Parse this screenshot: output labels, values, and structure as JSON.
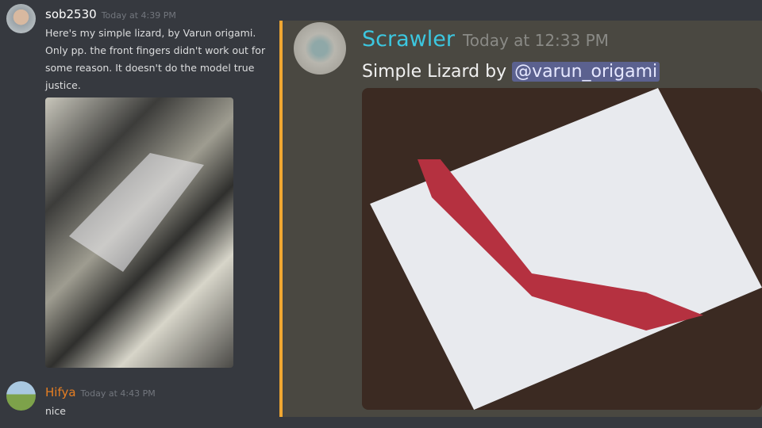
{
  "messages": [
    {
      "author": "sob2530",
      "timestamp": "Today at 4:39 PM",
      "text": "Here's my simple lizard, by Varun origami. Only pp. the front fingers didn't work out for some reason. It doesn't do the model true justice.",
      "author_color": "#ffffff"
    },
    {
      "author": "Hifya",
      "timestamp": "Today at 4:43 PM",
      "text": "nice",
      "author_color": "#e67e22"
    }
  ],
  "quoted": {
    "author": "Scrawler",
    "timestamp": "Today at 12:33 PM",
    "text": "Simple Lizard by ",
    "mention": "@varun_origami",
    "author_color": "#3cc7e0",
    "accent": "#f0a732"
  }
}
